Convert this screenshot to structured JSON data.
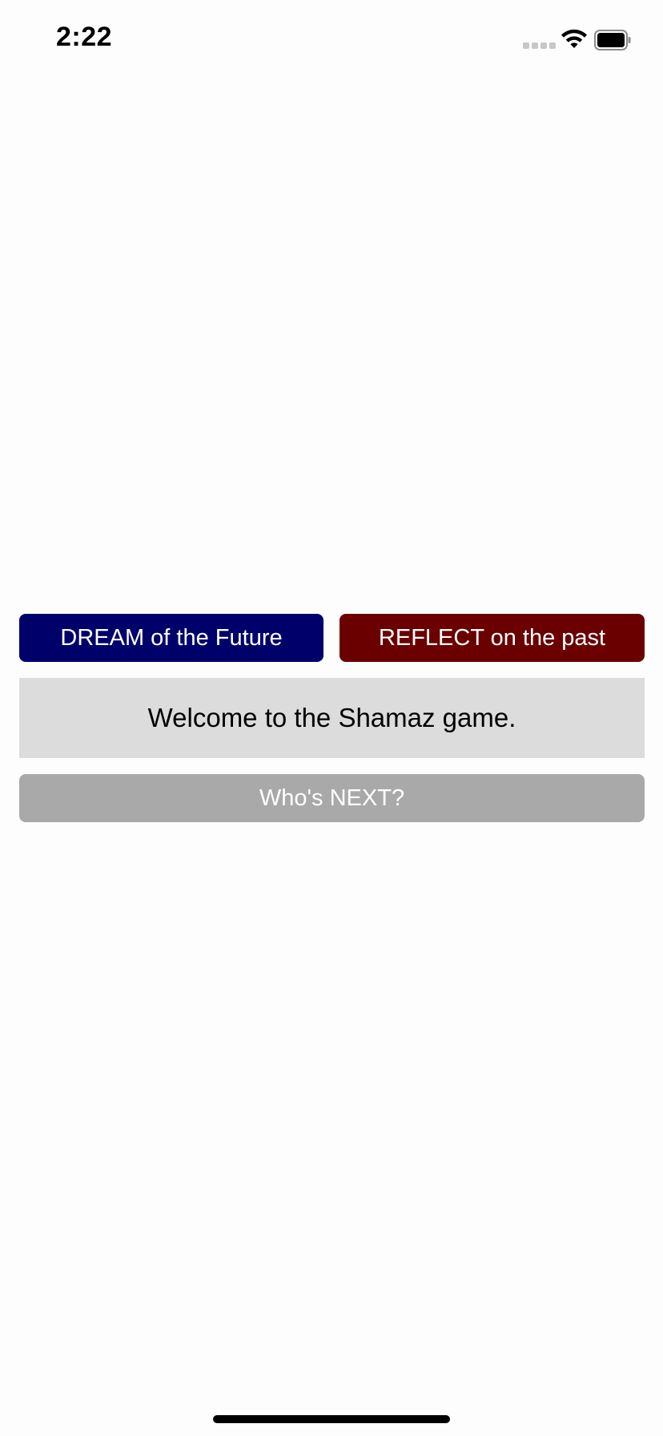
{
  "status_bar": {
    "time": "2:22",
    "signal_icon": "signal-dots-icon",
    "wifi_icon": "wifi-icon",
    "battery_icon": "battery-icon",
    "battery_level": 1.0
  },
  "actions": {
    "dream_label": "DREAM of the Future",
    "reflect_label": "REFLECT on the past",
    "dream_color": "#00006a",
    "reflect_color": "#6a0000"
  },
  "message": {
    "text": "Welcome to the Shamaz game."
  },
  "next": {
    "label": "Who's NEXT?",
    "color": "#a9a9a9"
  }
}
